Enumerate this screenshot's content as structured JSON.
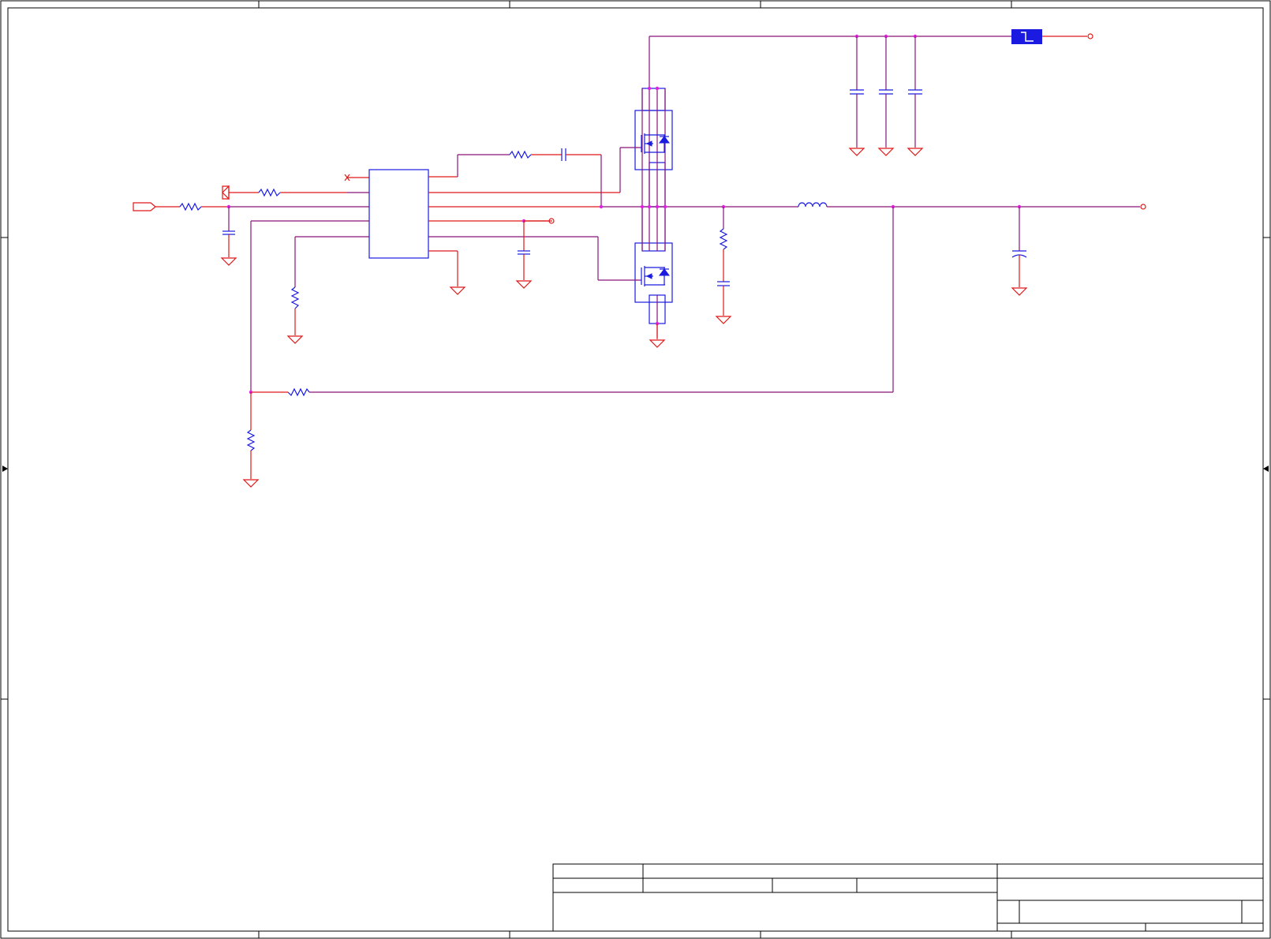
{
  "schematic": {
    "colors": {
      "wire": "#8a1478",
      "pin": "#e01818",
      "body": "#1a1ae0",
      "junction": "#e020e0",
      "frame": "#000000"
    },
    "components": {
      "controller_ic": "controller-ic",
      "high_side_mosfet": "high-side-mosfet",
      "low_side_mosfet": "low-side-mosfet",
      "inductor": "output-inductor",
      "ferrite": "input-ferrite-bead",
      "input_connector": "input-port-icon"
    }
  }
}
